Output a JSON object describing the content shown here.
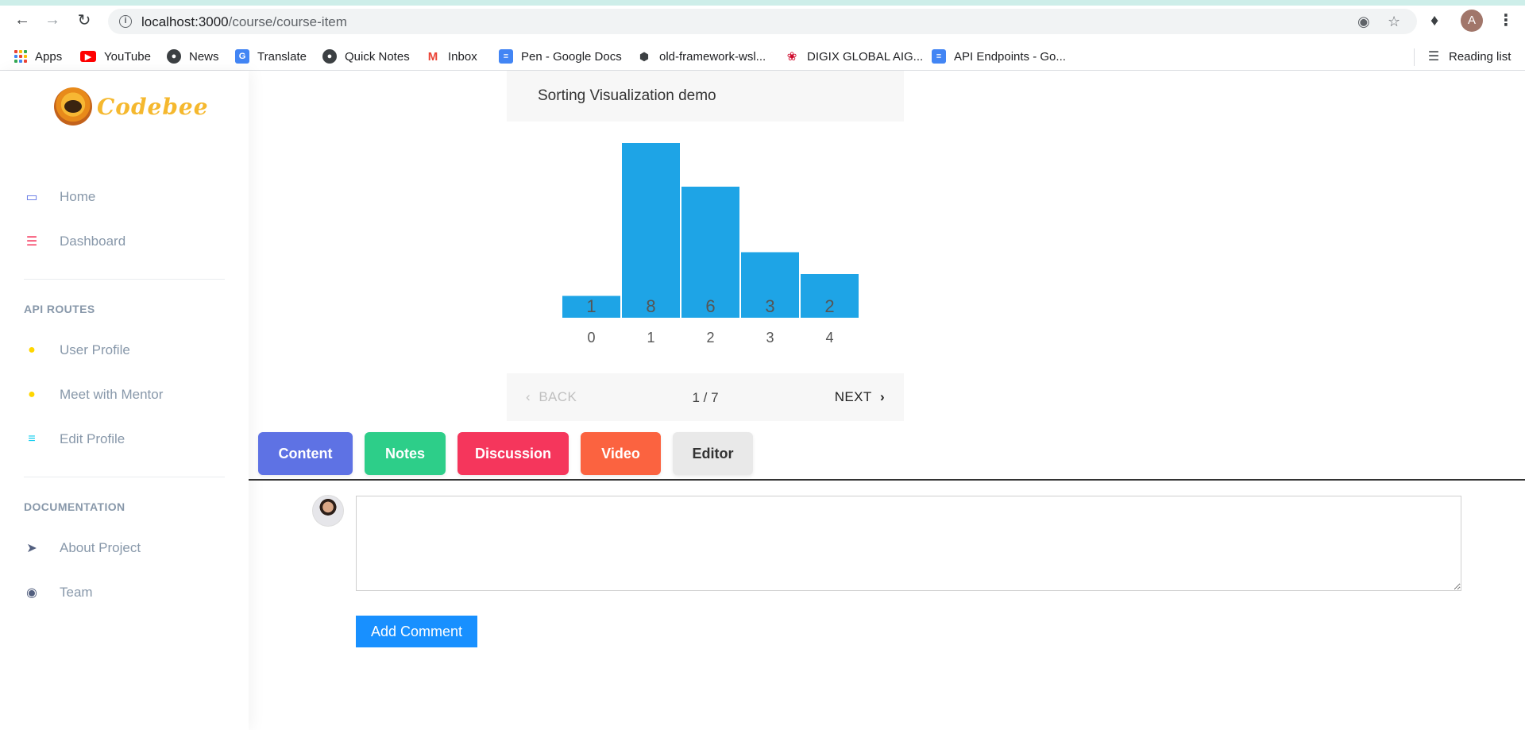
{
  "browser": {
    "url_host": "localhost:3000",
    "url_path": "/course/course-item",
    "profile_initial": "A",
    "bookmarks": [
      {
        "label": "Apps",
        "icon": "apps-grid-icon"
      },
      {
        "label": "YouTube",
        "icon": "youtube-icon",
        "color": "#ff0000"
      },
      {
        "label": "News",
        "icon": "globe-icon"
      },
      {
        "label": "Translate",
        "icon": "translate-icon",
        "color": "#4285f4"
      },
      {
        "label": "Quick Notes",
        "icon": "globe-icon"
      },
      {
        "label": "Inbox",
        "icon": "gmail-icon",
        "color": "#ea4335"
      },
      {
        "label": "Pen - Google Docs",
        "icon": "docs-icon",
        "color": "#4285f4"
      },
      {
        "label": "old-framework-wsl...",
        "icon": "cube-icon"
      },
      {
        "label": "DIGIX GLOBAL AIG...",
        "icon": "huawei-icon",
        "color": "#cf0a2c"
      },
      {
        "label": "API Endpoints - Go...",
        "icon": "docs-icon",
        "color": "#4285f4"
      }
    ],
    "reading_list": "Reading list"
  },
  "sidebar": {
    "brand": "Codebee",
    "brand_color": "#f5b82e",
    "items": [
      {
        "label": "Home",
        "icon": "monitor-icon",
        "color": "#5e72e4"
      },
      {
        "label": "Dashboard",
        "icon": "list-icon",
        "color": "#f5365c"
      }
    ],
    "section_api": "API ROUTES",
    "api_items": [
      {
        "label": "User Profile",
        "icon": "user-icon",
        "color": "#ffd600"
      },
      {
        "label": "Meet with Mentor",
        "icon": "user-icon",
        "color": "#ffd600"
      },
      {
        "label": "Edit Profile",
        "icon": "bullet-list-icon",
        "color": "#11cdef"
      }
    ],
    "section_docs": "DOCUMENTATION",
    "doc_items": [
      {
        "label": "About Project",
        "icon": "rocket-icon",
        "color": "#525f7f"
      },
      {
        "label": "Team",
        "icon": "palette-icon",
        "color": "#525f7f"
      }
    ]
  },
  "visualization": {
    "title": "Sorting Visualization demo",
    "back": "BACK",
    "page": "1 / 7",
    "next": "NEXT"
  },
  "chart_data": {
    "type": "bar",
    "categories": [
      "0",
      "1",
      "2",
      "3",
      "4"
    ],
    "values": [
      1,
      8,
      6,
      3,
      2
    ],
    "ylim": [
      0,
      8
    ],
    "bar_color": "#1ea4e6",
    "grid": false
  },
  "tabs": [
    {
      "label": "Content",
      "color": "#5e72e4"
    },
    {
      "label": "Notes",
      "color": "#2dce89"
    },
    {
      "label": "Discussion",
      "color": "#f5365c"
    },
    {
      "label": "Video",
      "color": "#fb6340"
    },
    {
      "label": "Editor",
      "color": "#e9e9e9"
    }
  ],
  "comment": {
    "placeholder": "",
    "button": "Add Comment"
  }
}
